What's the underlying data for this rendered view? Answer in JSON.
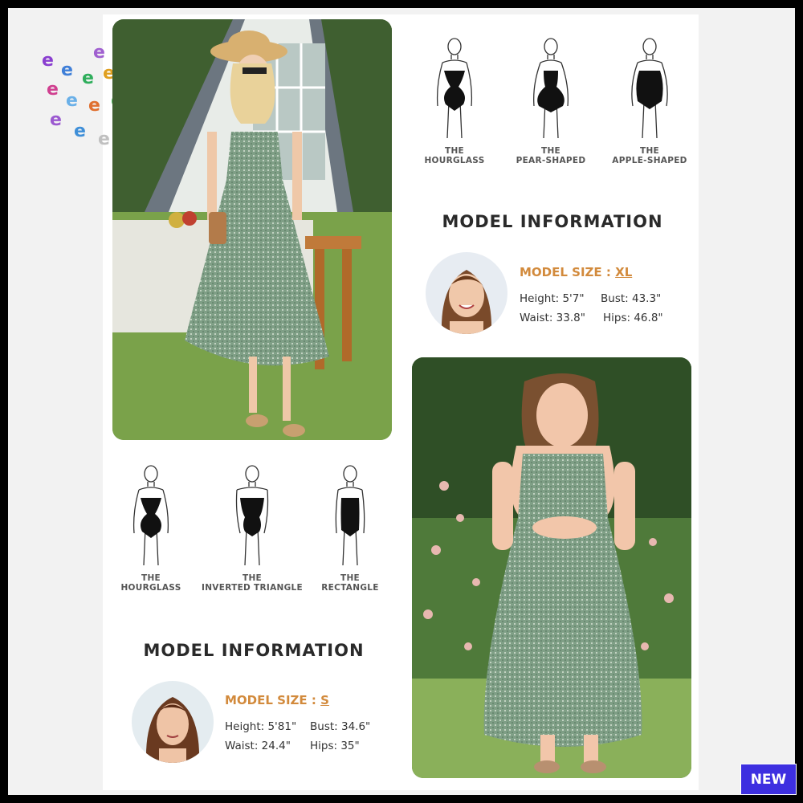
{
  "badge": {
    "new_label": "NEW"
  },
  "top_right": {
    "shapes": [
      {
        "line1": "THE",
        "line2": "HOURGLASS"
      },
      {
        "line1": "THE",
        "line2": "PEAR-SHAPED"
      },
      {
        "line1": "THE",
        "line2": "APPLE-SHAPED"
      }
    ],
    "heading": "MODEL INFORMATION",
    "size_label": "MODEL SIZE :",
    "size_value": "XL",
    "height": "Height: 5'7\"",
    "bust": "Bust: 43.3\"",
    "waist": "Waist: 33.8\"",
    "hips": "Hips: 46.8\""
  },
  "bottom_left": {
    "shapes": [
      {
        "line1": "THE",
        "line2": "HOURGLASS"
      },
      {
        "line1": "THE",
        "line2": "INVERTED TRIANGLE"
      },
      {
        "line1": "THE",
        "line2": "RECTANGLE"
      }
    ],
    "heading": "MODEL INFORMATION",
    "size_label": "MODEL SIZE :",
    "size_value": "S",
    "height": "Height: 5'81\"",
    "bust": "Bust: 34.6\"",
    "waist": "Waist: 24.4\"",
    "hips": "Hips: 35\""
  },
  "colors": {
    "accent": "#d28a3c",
    "badge": "#3d2fe0",
    "dress": "#7f9f86"
  }
}
